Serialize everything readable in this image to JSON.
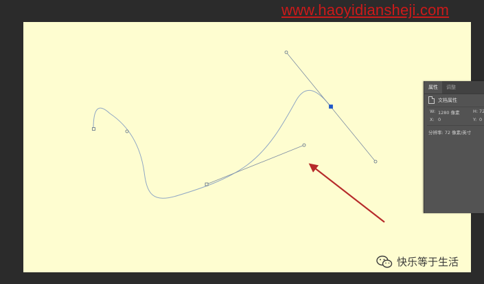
{
  "watermark": {
    "url": "www.haoyidiansheji.com",
    "color": "#cc1a1a"
  },
  "canvas": {
    "background": "#fefdd0"
  },
  "path": {
    "stroke_color": "#8fa6c4",
    "handle_color": "#7b8ba3",
    "anchor_selected_color": "#1f57c9"
  },
  "annotation": {
    "arrow_color": "#b62a2a"
  },
  "properties_panel": {
    "tabs": [
      "属性",
      "调整"
    ],
    "active_tab": "属性",
    "doc_label": "文档属性",
    "w_label": "W:",
    "w_value": "1280 像素",
    "h_label": "H:",
    "h_value": "72",
    "x_label": "X:",
    "x_value": "0",
    "y_label": "Y:",
    "y_value": "0",
    "resolution": "分辨率: 72 像素/英寸"
  },
  "signature": {
    "text": "快乐等于生活",
    "icon": "wechat-icon"
  }
}
